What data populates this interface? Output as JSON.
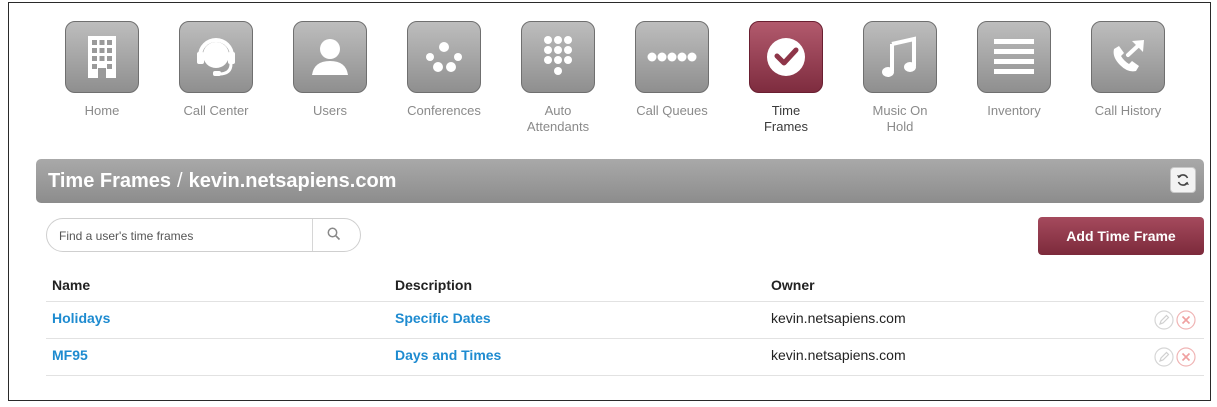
{
  "nav": {
    "items": [
      {
        "label": "Home",
        "icon": "building-icon"
      },
      {
        "label": "Call Center",
        "icon": "headset-icon"
      },
      {
        "label": "Users",
        "icon": "user-icon"
      },
      {
        "label": "Conferences",
        "icon": "conference-dots-icon"
      },
      {
        "label": "Auto\nAttendants",
        "icon": "keypad-icon"
      },
      {
        "label": "Call Queues",
        "icon": "queue-dots-icon"
      },
      {
        "label": "Time\nFrames",
        "icon": "clock-icon",
        "active": true
      },
      {
        "label": "Music On\nHold",
        "icon": "music-note-icon"
      },
      {
        "label": "Inventory",
        "icon": "list-lines-icon"
      },
      {
        "label": "Call History",
        "icon": "phone-arrow-icon"
      }
    ]
  },
  "header": {
    "title": "Time Frames",
    "separator": "/",
    "domain": "kevin.netsapiens.com"
  },
  "search": {
    "placeholder": "Find a user's time frames",
    "value": ""
  },
  "actions": {
    "add_label": "Add Time Frame"
  },
  "table": {
    "columns": [
      "Name",
      "Description",
      "Owner"
    ],
    "rows": [
      {
        "name": "Holidays",
        "description": "Specific Dates",
        "owner": "kevin.netsapiens.com"
      },
      {
        "name": "MF95",
        "description": "Days and Times",
        "owner": "kevin.netsapiens.com"
      }
    ]
  },
  "colors": {
    "accent": "#8e3548",
    "tile_gray": "#a3a3a3",
    "link": "#1e8bd0"
  }
}
